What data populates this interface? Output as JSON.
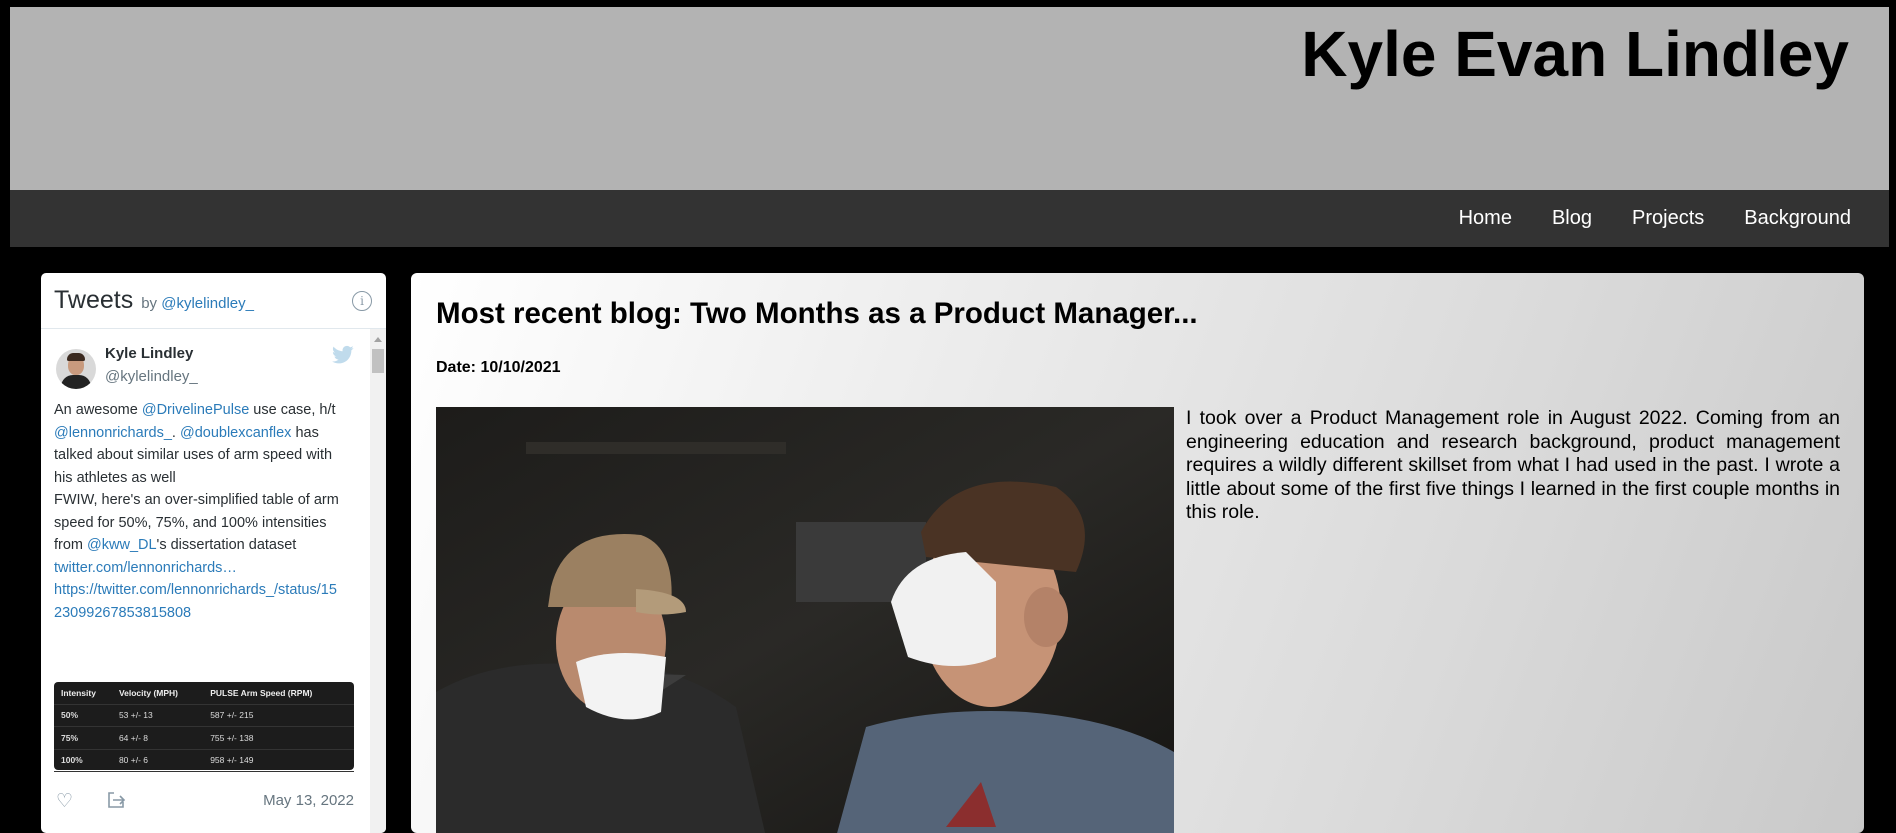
{
  "site": {
    "title": "Kyle Evan Lindley"
  },
  "nav": {
    "items": [
      {
        "label": "Home"
      },
      {
        "label": "Blog"
      },
      {
        "label": "Projects"
      },
      {
        "label": "Background"
      }
    ]
  },
  "twitter_widget": {
    "title": "Tweets",
    "by_prefix": "by",
    "by_handle": "@kylelindley_",
    "info_icon": "info-icon",
    "tweet": {
      "author_name": "Kyle Lindley",
      "author_handle": "@kylelindley_",
      "lines": [
        [
          {
            "t": "An awesome "
          },
          {
            "t": "@DrivelinePulse",
            "link": true
          },
          {
            "t": " use case, h/t"
          }
        ],
        [
          {
            "t": "@lennonrichards_",
            "link": true
          },
          {
            "t": ". "
          },
          {
            "t": "@doublexcanflex",
            "link": true
          },
          {
            "t": " has"
          }
        ],
        [
          {
            "t": "talked about similar uses of arm speed with"
          }
        ],
        [
          {
            "t": "his athletes as well"
          }
        ],
        [
          {
            "t": " "
          }
        ],
        [
          {
            "t": "FWIW, here's an over-simplified table of arm"
          }
        ],
        [
          {
            "t": "speed for 50%, 75%, and 100% intensities"
          }
        ],
        [
          {
            "t": "from "
          },
          {
            "t": "@kww_DL",
            "link": true
          },
          {
            "t": "'s dissertation dataset"
          }
        ],
        [
          {
            "t": "twitter.com/lennonrichards…",
            "link": true
          }
        ],
        [
          {
            "t": "https://twitter.com/lennonrichards_/status/15",
            "link": true
          }
        ],
        [
          {
            "t": "23099267853815808",
            "link": true
          }
        ]
      ],
      "table": {
        "headers": [
          "Intensity",
          "Velocity (MPH)",
          "PULSE Arm Speed (RPM)"
        ],
        "rows": [
          [
            "50%",
            "53 +/- 13",
            "587 +/- 215"
          ],
          [
            "75%",
            "64 +/- 8",
            "755 +/- 138"
          ],
          [
            "100%",
            "80 +/- 6",
            "958 +/- 149"
          ]
        ]
      },
      "date": "May 13, 2022",
      "heart_icon": "heart-icon",
      "share_icon": "share-icon"
    }
  },
  "blog": {
    "heading": "Most recent blog: Two Months as a Product Manager...",
    "date": "Date: 10/10/2021",
    "excerpt": "I took over a Product Management role in August 2022. Coming from an engineering education and research background, product management requires a wildly different skillset from what I had used in the past. I wrote a little about some of the first five things I learned in the first couple months in this role."
  },
  "colors": {
    "header_bg": "#b3b3b3",
    "nav_bg": "#333333",
    "page_bg": "#000000",
    "link": "#2b7bb9"
  }
}
